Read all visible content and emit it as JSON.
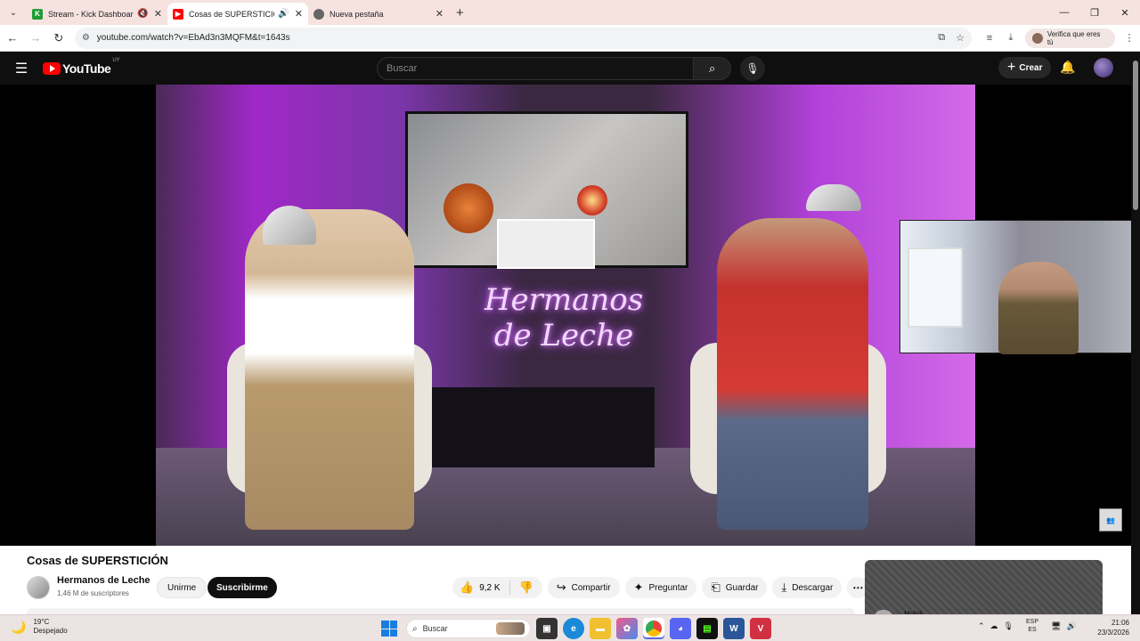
{
  "browser": {
    "tabs": [
      {
        "title": "Stream - Kick Dashboard",
        "favicon_color": "#1f9d32",
        "favicon_glyph": "K",
        "audio_icon": "muted-speaker-icon"
      },
      {
        "title": "Cosas de SUPERSTICIÓN - Y",
        "favicon_color": "#ff0000",
        "favicon_glyph": "",
        "audio_icon": "speaker-icon"
      },
      {
        "title": "Nueva pestaña",
        "favicon_color": "#666666",
        "favicon_glyph": ""
      }
    ],
    "url": "youtube.com/watch?v=EbAd3n3MQFM&t=1643s",
    "verify_label": "Verifica que eres tú"
  },
  "youtube": {
    "logo_text": "YouTube",
    "country_code": "UY",
    "search_placeholder": "Buscar",
    "create_label": "Crear"
  },
  "video": {
    "title": "Cosas de SUPERSTICIÓN",
    "channel_name": "Hermanos de Leche",
    "subscribers": "1,46 M de suscriptores",
    "join_label": "Unirme",
    "subscribe_label": "Suscribirme",
    "likes": "9,2 K",
    "share_label": "Compartir",
    "ask_label": "Preguntar",
    "save_label": "Guardar",
    "download_label": "Descargar"
  },
  "sidebar_card": {
    "partial_text": "Mobili..."
  },
  "taskbar": {
    "weather_temp": "19°C",
    "weather_desc": "Despejado",
    "search_label": "Buscar",
    "lang_top": "ESP",
    "lang_bottom": "ES",
    "time": "21:06",
    "date": "23/3/2026"
  },
  "colors": {
    "youtube_red": "#ff0000",
    "dark_bg": "#0f0f0f",
    "accent_blue": "#1a7de0"
  }
}
